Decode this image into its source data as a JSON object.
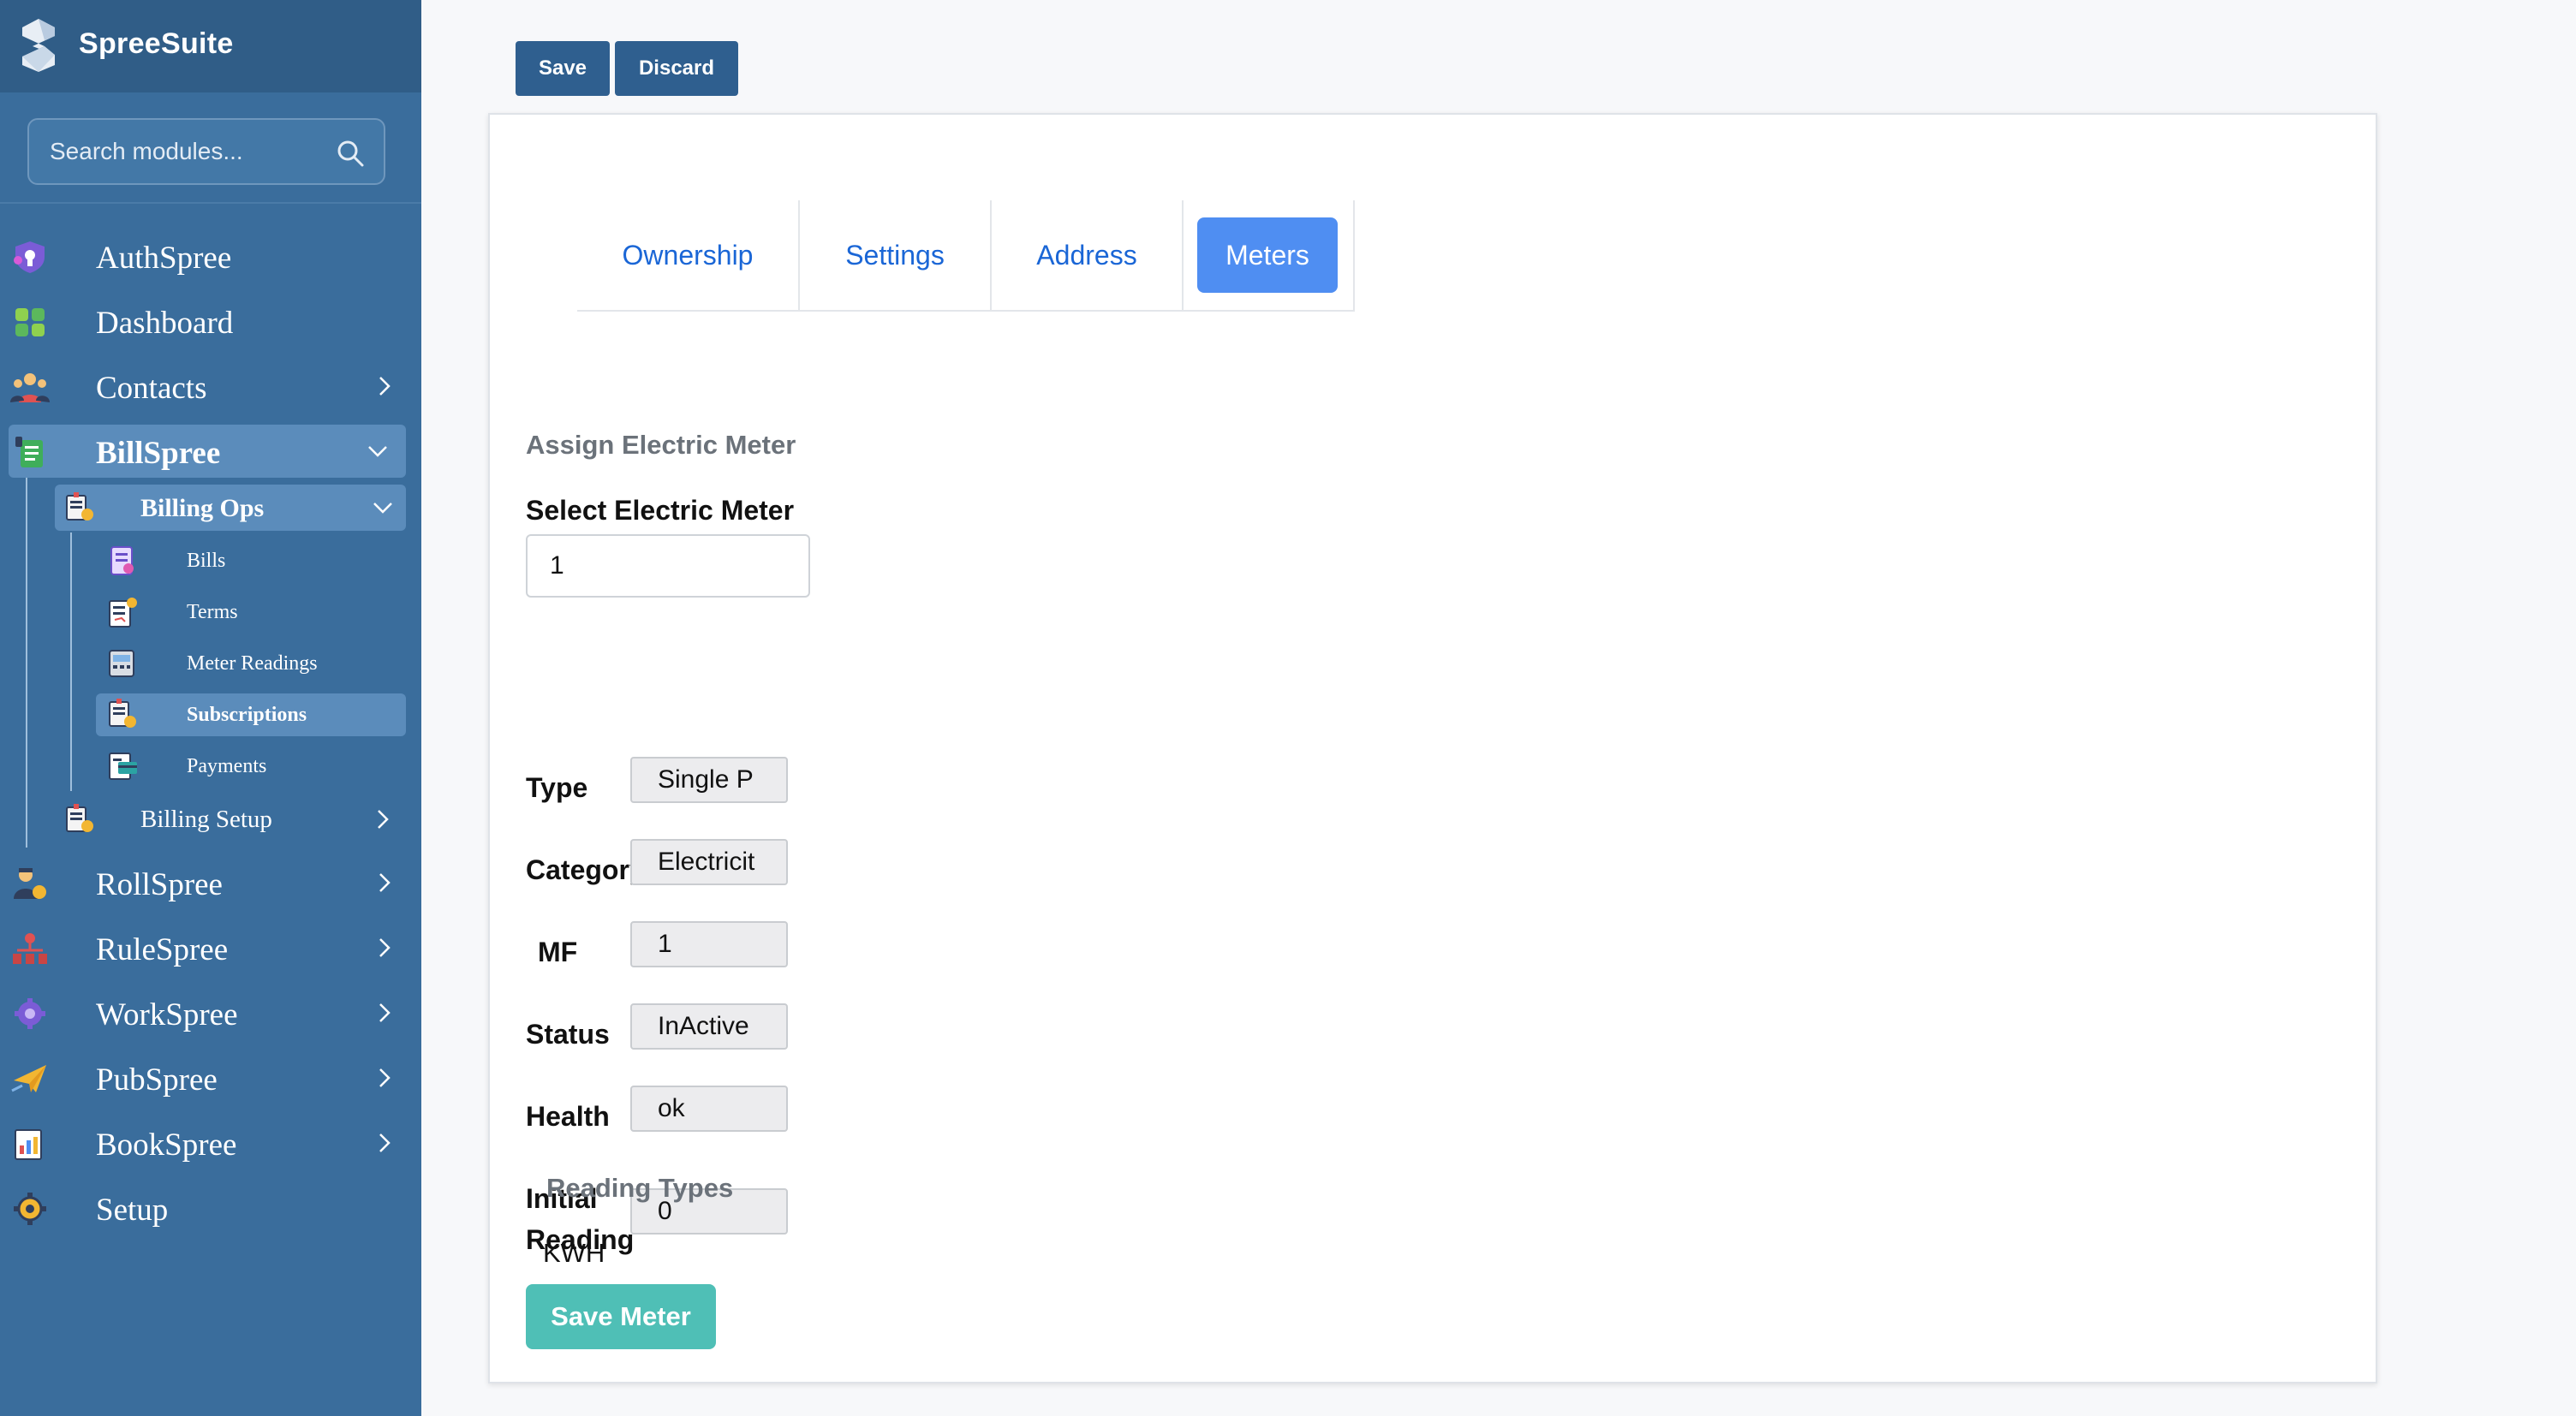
{
  "app": {
    "name": "SpreeSuite"
  },
  "search": {
    "placeholder": "Search modules..."
  },
  "sidebar": {
    "authspree": "AuthSpree",
    "dashboard": "Dashboard",
    "contacts": "Contacts",
    "billspree": "BillSpree",
    "billing_ops": "Billing Ops",
    "bills": "Bills",
    "terms": "Terms",
    "meter_readings": "Meter Readings",
    "subscriptions": "Subscriptions",
    "payments": "Payments",
    "billing_setup": "Billing Setup",
    "rollspree": "RollSpree",
    "rulespree": "RuleSpree",
    "workspree": "WorkSpree",
    "pubspree": "PubSpree",
    "bookspree": "BookSpree",
    "setup": "Setup"
  },
  "toolbar": {
    "save": "Save",
    "discard": "Discard"
  },
  "tabs": {
    "ownership": "Ownership",
    "settings": "Settings",
    "address": "Address",
    "meters": "Meters"
  },
  "form": {
    "section_title": "Assign Electric Meter",
    "select_label": "Select Electric Meter",
    "select_value": "1",
    "type_label": "Type",
    "type_value": "Single P",
    "category_label": "Category",
    "category_value": "Electricit",
    "mf_label": "MF",
    "mf_value": "1",
    "status_label": "Status",
    "status_value": "InActive",
    "health_label": "Health",
    "health_value": "ok",
    "initial_reading_label_1": "Initial",
    "initial_reading_label_2": "Reading",
    "initial_reading_value": "0",
    "reading_types_title": "Reading Types",
    "reading_type_1": "KWH",
    "save_meter": "Save Meter"
  },
  "colors": {
    "sidebar_bg": "#3a6d9c",
    "brand_bg": "#305d87",
    "active_item": "#5b8cbb",
    "tab_active": "#4f8ef2",
    "tab_link": "#1a66d6",
    "primary_button": "#2f5f8f",
    "save_meter_button": "#4fbfb6"
  }
}
